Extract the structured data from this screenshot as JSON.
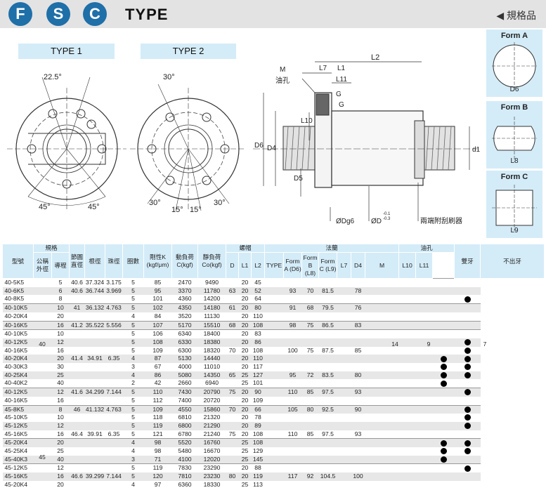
{
  "header": {
    "badges": [
      "F",
      "S",
      "C"
    ],
    "title": "TYPE",
    "spec_tag": "◀ 規格品"
  },
  "drawing": {
    "type1_label": "TYPE 1",
    "type2_label": "TYPE 2",
    "type1_angle": "22.5°",
    "type1_angle2": "45°",
    "type1_angle3": "45°",
    "type2_angle_top": "30°",
    "type2_angle_bl": "30°",
    "type2_angle_b1": "15°",
    "type2_angle_b2": "15°",
    "type2_angle_br": "30°",
    "labels": {
      "M": "M",
      "oil_hole": "油孔",
      "L7": "L7",
      "L1": "L1",
      "L11": "L11",
      "L2": "L2",
      "G1": "G",
      "G2": "G",
      "L10": "L10",
      "D6": "D6",
      "D4": "D4",
      "D5": "D5",
      "d1": "d1",
      "Dg6": "ØDg6",
      "D": "ØD",
      "D_tol_top": "-0.1",
      "D_tol_bot": "-0.3",
      "wiper": "兩端附刮刷器"
    },
    "forms": [
      {
        "name": "Form A",
        "dim": "D6"
      },
      {
        "name": "Form B",
        "dim": "L8"
      },
      {
        "name": "Form C",
        "dim": "L9"
      }
    ]
  },
  "table": {
    "headers": {
      "model": "型號",
      "spec": "規格",
      "nominal_od": "公稱外徑",
      "lead": "導程",
      "pitch_dia": "節圓直徑",
      "root_dia": "根徑",
      "ball_dia": "珠徑",
      "turns": "圈數",
      "stiffness": "剛性K (kgf/μm)",
      "dyn_load": "動負荷 C(kgf)",
      "static_load": "靜負荷 Co(kgf)",
      "nut": "螺帽",
      "D": "D",
      "L1": "L1",
      "L2": "L2",
      "flange": "法蘭",
      "TYPE": "TYPE",
      "formA": "Form A (D6)",
      "formB": "Form B (L8)",
      "formC": "Form C (L9)",
      "L7": "L7",
      "D4": "D4",
      "oil_hole": "油孔",
      "M": "M",
      "L10": "L10",
      "L11": "L11",
      "double": "雙牙",
      "flush": "不出牙"
    },
    "rows": [
      {
        "model": "40-5K5",
        "lead": "5",
        "pitch": "40.6",
        "root": "37.324",
        "ball": "3.175",
        "turns": "5",
        "k": "85",
        "c": "2470",
        "co": "9490",
        "D": "",
        "L1": "20",
        "L2": "45",
        "fa": "",
        "fb": "",
        "fc": "",
        "D4": "",
        "dbl": "",
        "flush": ""
      },
      {
        "model": "40-6K5",
        "lead": "6",
        "pitch": "40.6",
        "root": "36.744",
        "ball": "3.969",
        "turns": "5",
        "k": "95",
        "c": "3370",
        "co": "11780",
        "D": "63",
        "L1": "20",
        "L2": "52",
        "fa": "93",
        "fb": "70",
        "fc": "81.5",
        "D4": "78",
        "dbl": "",
        "flush": ""
      },
      {
        "model": "40-8K5",
        "lead": "8",
        "pitch": "",
        "root": "",
        "ball": "",
        "turns": "5",
        "k": "101",
        "c": "4360",
        "co": "14200",
        "D": "",
        "L1": "20",
        "L2": "64",
        "fa": "",
        "fb": "",
        "fc": "",
        "D4": "",
        "dbl": "",
        "flush": "●"
      },
      {
        "model": "40-10K5",
        "lead": "10",
        "pitch": "41",
        "root": "36.132",
        "ball": "4.763",
        "turns": "5",
        "k": "102",
        "c": "4350",
        "co": "14180",
        "D": "61",
        "L1": "20",
        "L2": "80",
        "fa": "91",
        "fb": "68",
        "fc": "79.5",
        "D4": "76",
        "dbl": "",
        "flush": ""
      },
      {
        "model": "40-20K4",
        "lead": "20",
        "pitch": "",
        "root": "",
        "ball": "",
        "turns": "4",
        "k": "84",
        "c": "3520",
        "co": "11130",
        "D": "",
        "L1": "20",
        "L2": "110",
        "fa": "",
        "fb": "",
        "fc": "",
        "D4": "",
        "dbl": "",
        "flush": ""
      },
      {
        "model": "40-16K5",
        "lead": "16",
        "pitch": "41.2",
        "root": "35.522",
        "ball": "5.556",
        "turns": "5",
        "k": "107",
        "c": "5170",
        "co": "15510",
        "D": "68",
        "L1": "20",
        "L2": "108",
        "fa": "98",
        "fb": "75",
        "fc": "86.5",
        "D4": "83",
        "dbl": "",
        "flush": ""
      },
      {
        "model": "40-10K5",
        "lead": "10",
        "pitch": "",
        "root": "",
        "ball": "",
        "turns": "5",
        "k": "106",
        "c": "6340",
        "co": "18400",
        "D": "",
        "L1": "20",
        "L2": "83",
        "fa": "",
        "fb": "",
        "fc": "",
        "D4": "",
        "dbl": "",
        "flush": ""
      },
      {
        "model": "40-12K5",
        "lead": "12",
        "pitch": "",
        "root": "",
        "ball": "",
        "turns": "5",
        "k": "108",
        "c": "6330",
        "co": "18380",
        "D": "",
        "L1": "20",
        "L2": "86",
        "fa": "",
        "fb": "",
        "fc": "",
        "D4": "",
        "dbl": "",
        "flush": "●"
      },
      {
        "model": "40-16K5",
        "lead": "16",
        "pitch": "",
        "root": "",
        "ball": "",
        "turns": "5",
        "k": "109",
        "c": "6300",
        "co": "18320",
        "D": "70",
        "L1": "20",
        "L2": "108",
        "fa": "100",
        "fb": "75",
        "fc": "87.5",
        "D4": "85",
        "dbl": "",
        "flush": "●"
      },
      {
        "model": "40-20K4",
        "lead": "20",
        "pitch": "41.4",
        "root": "34.91",
        "ball": "6.35",
        "turns": "4",
        "k": "87",
        "c": "5130",
        "co": "14440",
        "D": "",
        "L1": "20",
        "L2": "110",
        "fa": "",
        "fb": "",
        "fc": "",
        "D4": "",
        "dbl": "●",
        "flush": "●"
      },
      {
        "model": "40-30K3",
        "lead": "30",
        "pitch": "",
        "root": "",
        "ball": "",
        "turns": "3",
        "k": "67",
        "c": "4000",
        "co": "11010",
        "D": "",
        "L1": "20",
        "L2": "117",
        "fa": "",
        "fb": "",
        "fc": "",
        "D4": "",
        "dbl": "●",
        "flush": "●"
      },
      {
        "model": "40-25K4",
        "lead": "25",
        "pitch": "",
        "root": "",
        "ball": "",
        "turns": "4",
        "k": "86",
        "c": "5080",
        "co": "14350",
        "D": "65",
        "L1": "25",
        "L2": "127",
        "fa": "95",
        "fb": "72",
        "fc": "83.5",
        "D4": "80",
        "dbl": "●",
        "flush": "●"
      },
      {
        "model": "40-40K2",
        "lead": "40",
        "pitch": "",
        "root": "",
        "ball": "",
        "turns": "2",
        "k": "42",
        "c": "2660",
        "co": "6940",
        "D": "",
        "L1": "25",
        "L2": "101",
        "fa": "",
        "fb": "",
        "fc": "",
        "D4": "",
        "dbl": "●",
        "flush": ""
      },
      {
        "model": "40-12K5",
        "lead": "12",
        "pitch": "41.6",
        "root": "34.299",
        "ball": "7.144",
        "turns": "5",
        "k": "110",
        "c": "7430",
        "co": "20790",
        "D": "75",
        "L1": "20",
        "L2": "90",
        "fa": "110",
        "fb": "85",
        "fc": "97.5",
        "D4": "93",
        "dbl": "",
        "flush": "●"
      },
      {
        "model": "40-16K5",
        "lead": "16",
        "pitch": "",
        "root": "",
        "ball": "",
        "turns": "5",
        "k": "112",
        "c": "7400",
        "co": "20720",
        "D": "",
        "L1": "20",
        "L2": "109",
        "fa": "",
        "fb": "",
        "fc": "",
        "D4": "",
        "dbl": "",
        "flush": ""
      },
      {
        "model": "45-8K5",
        "lead": "8",
        "pitch": "46",
        "root": "41.132",
        "ball": "4.763",
        "turns": "5",
        "k": "109",
        "c": "4550",
        "co": "15860",
        "D": "70",
        "L1": "20",
        "L2": "66",
        "fa": "105",
        "fb": "80",
        "fc": "92.5",
        "D4": "90",
        "dbl": "",
        "flush": "●"
      },
      {
        "model": "45-10K5",
        "lead": "10",
        "pitch": "",
        "root": "",
        "ball": "",
        "turns": "5",
        "k": "118",
        "c": "6810",
        "co": "21320",
        "D": "",
        "L1": "20",
        "L2": "78",
        "fa": "",
        "fb": "",
        "fc": "",
        "D4": "",
        "dbl": "",
        "flush": "●"
      },
      {
        "model": "45-12K5",
        "lead": "12",
        "pitch": "",
        "root": "",
        "ball": "",
        "turns": "5",
        "k": "119",
        "c": "6800",
        "co": "21290",
        "D": "",
        "L1": "20",
        "L2": "89",
        "fa": "",
        "fb": "",
        "fc": "",
        "D4": "",
        "dbl": "",
        "flush": "●"
      },
      {
        "model": "45-16K5",
        "lead": "16",
        "pitch": "46.4",
        "root": "39.91",
        "ball": "6.35",
        "turns": "5",
        "k": "121",
        "c": "6780",
        "co": "21240",
        "D": "75",
        "L1": "20",
        "L2": "108",
        "fa": "110",
        "fb": "85",
        "fc": "97.5",
        "D4": "93",
        "dbl": "",
        "flush": ""
      },
      {
        "model": "45-20K4",
        "lead": "20",
        "pitch": "",
        "root": "",
        "ball": "",
        "turns": "4",
        "k": "98",
        "c": "5520",
        "co": "16760",
        "D": "",
        "L1": "25",
        "L2": "108",
        "fa": "",
        "fb": "",
        "fc": "",
        "D4": "",
        "dbl": "●",
        "flush": "●"
      },
      {
        "model": "45-25K4",
        "lead": "25",
        "pitch": "",
        "root": "",
        "ball": "",
        "turns": "4",
        "k": "98",
        "c": "5480",
        "co": "16670",
        "D": "",
        "L1": "25",
        "L2": "129",
        "fa": "",
        "fb": "",
        "fc": "",
        "D4": "",
        "dbl": "●",
        "flush": "●"
      },
      {
        "model": "45-40K3",
        "lead": "40",
        "pitch": "",
        "root": "",
        "ball": "",
        "turns": "3",
        "k": "71",
        "c": "4100",
        "co": "12020",
        "D": "",
        "L1": "25",
        "L2": "145",
        "fa": "",
        "fb": "",
        "fc": "",
        "D4": "",
        "dbl": "●",
        "flush": ""
      },
      {
        "model": "45-12K5",
        "lead": "12",
        "pitch": "",
        "root": "",
        "ball": "",
        "turns": "5",
        "k": "119",
        "c": "7830",
        "co": "23290",
        "D": "",
        "L1": "20",
        "L2": "88",
        "fa": "",
        "fb": "",
        "fc": "",
        "D4": "",
        "dbl": "",
        "flush": "●"
      },
      {
        "model": "45-16K5",
        "lead": "16",
        "pitch": "46.6",
        "root": "39.299",
        "ball": "7.144",
        "turns": "5",
        "k": "120",
        "c": "7810",
        "co": "23230",
        "D": "80",
        "L1": "20",
        "L2": "119",
        "fa": "117",
        "fb": "92",
        "fc": "104.5",
        "D4": "100",
        "dbl": "",
        "flush": ""
      },
      {
        "model": "45-20K4",
        "lead": "20",
        "pitch": "",
        "root": "",
        "ball": "",
        "turns": "4",
        "k": "97",
        "c": "6360",
        "co": "18330",
        "D": "",
        "L1": "25",
        "L2": "113",
        "fa": "",
        "fb": "",
        "fc": "",
        "D4": "",
        "dbl": "",
        "flush": ""
      }
    ],
    "merged": {
      "od40": "40",
      "od45": "45",
      "L7": "14",
      "M": "9",
      "L11": "7"
    }
  }
}
